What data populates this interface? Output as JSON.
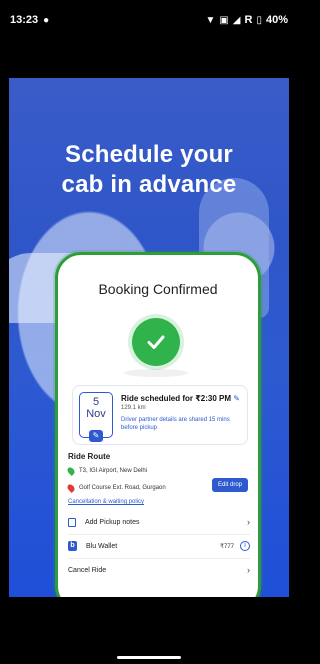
{
  "status": {
    "time": "13:23",
    "network": "R",
    "battery": "40%"
  },
  "hero": {
    "title_line1": "Schedule your",
    "title_line2": "cab in advance"
  },
  "card": {
    "title": "Booking Confirmed",
    "schedule": {
      "day": "5",
      "month": "Nov",
      "title": "Ride scheduled for ₹2:30 PM",
      "distance": "129.1 km",
      "note": "Driver partner details are shared 15 mins before pickup"
    },
    "route": {
      "label": "Ride Route",
      "pickup": "T3, IGI Airport, New Delhi",
      "drop": "Golf Course Ext. Road, Gurgaon",
      "edit_drop": "Edit drop",
      "policy_link": "Cancellation & waiting policy"
    },
    "rows": {
      "pickup_notes": "Add Pickup notes",
      "wallet_label": "Blu Wallet",
      "wallet_amount": "₹777",
      "cancel": "Cancel Ride"
    }
  },
  "colors": {
    "accent_blue": "#2e5ad0",
    "success_green": "#2fb34a",
    "drop_red": "#e23b2f"
  }
}
